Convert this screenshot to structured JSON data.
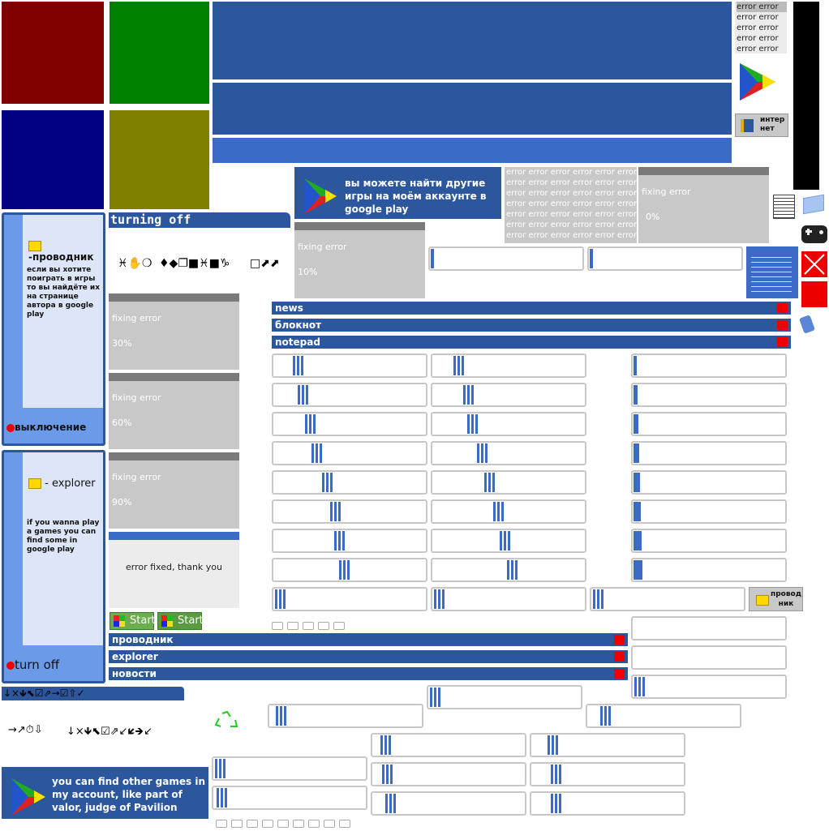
{
  "tiles": {
    "red": "#800000",
    "green": "#008000",
    "navy": "#000080",
    "olive": "#808000"
  },
  "error_list": [
    "error error",
    "error error",
    "error error",
    "error error",
    "error error"
  ],
  "internet_button": {
    "line1": "интер",
    "line2": "нет"
  },
  "explorer_button": {
    "line1": "провод",
    "line2": "ник"
  },
  "play_banner_ru": "вы можете найти другие игры на моём аккаунте в google play",
  "play_banner_en": "you can find other games in my account, like part of valor, judge of Pavilion",
  "error_grid_text": "error error error error error error",
  "panels": [
    {
      "label": "fixing error",
      "value": "0%"
    },
    {
      "label": "fixing error",
      "value": "10%"
    },
    {
      "label": "fixing error",
      "value": "30%"
    },
    {
      "label": "fixing error",
      "value": "60%"
    },
    {
      "label": "fixing error",
      "value": "90%"
    }
  ],
  "fixed_message": "error fixed, thank you",
  "turning_off_title": "turning off",
  "wingdings_row1a": "♓✋❍",
  "wingdings_row1b": "♦◆❐■♓■♑",
  "wingdings_row1c": "□⬈⬈",
  "windows_top": [
    {
      "title": "news"
    },
    {
      "title": "блокнот"
    },
    {
      "title": "notepad"
    }
  ],
  "windows_bottom": [
    {
      "title": "проводник"
    },
    {
      "title": "explorer"
    },
    {
      "title": "новости"
    }
  ],
  "menu_ru": {
    "explorer_label": "-проводник",
    "text": "если вы хотите поиграть в игры то вы найдёте их на странице автора в google play",
    "shutdown_label": "выключение"
  },
  "menu_en": {
    "explorer_label": " - explorer",
    "text": "if you wanna play a games you can find some in google play",
    "shutdown_label": "turn off"
  },
  "start_labels": [
    "Start",
    "Start"
  ],
  "arrows_header": "↓×🡻⬉☑⇗→☑⇧✓",
  "arrows_row_a": "→↗⏱⇩",
  "arrows_row_b": "↓×🡻⬉☑⇗↙🡿🡺↙",
  "progress_fractions": {
    "col1": [
      0.13,
      0.16,
      0.21,
      0.25,
      0.32,
      0.37,
      0.4,
      0.43
    ],
    "col2": [
      0.14,
      0.2,
      0.23,
      0.29,
      0.34,
      0.4,
      0.44,
      0.49
    ],
    "col3": [
      0.0,
      0.0,
      0.0,
      0.0,
      0.0,
      0.01,
      0.0,
      0.0
    ]
  },
  "colors": {
    "accent": "#2c579d",
    "light_accent": "#3b6bc7",
    "panel": "#c8c8c8",
    "close": "#e00000"
  }
}
